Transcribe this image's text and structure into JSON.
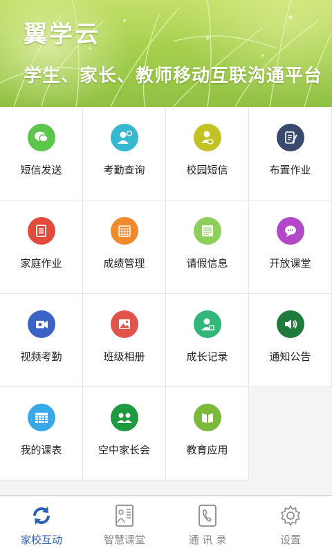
{
  "header": {
    "title": "翼学云",
    "subtitle": "学生、家长、教师移动互联沟通平台"
  },
  "grid": {
    "items": [
      {
        "label": "短信发送",
        "icon": "chat-bubble-icon",
        "color": "#5cc54b"
      },
      {
        "label": "考勤查询",
        "icon": "person-check-icon",
        "color": "#36b8cf"
      },
      {
        "label": "校园短信",
        "icon": "person-message-icon",
        "color": "#c2c224"
      },
      {
        "label": "布置作业",
        "icon": "edit-document-icon",
        "color": "#3a4a6e"
      },
      {
        "label": "家庭作业",
        "icon": "list-document-icon",
        "color": "#e24b3b"
      },
      {
        "label": "成绩管理",
        "icon": "calendar-grid-icon",
        "color": "#f08a2c"
      },
      {
        "label": "请假信息",
        "icon": "leave-form-icon",
        "color": "#8ccf5a"
      },
      {
        "label": "开放课堂",
        "icon": "speech-bubble-icon",
        "color": "#b447c8"
      },
      {
        "label": "视频考勤",
        "icon": "video-camera-icon",
        "color": "#3b63c6"
      },
      {
        "label": "班级相册",
        "icon": "photo-album-icon",
        "color": "#e0544b"
      },
      {
        "label": "成长记录",
        "icon": "person-badge-icon",
        "color": "#2fb87a"
      },
      {
        "label": "通知公告",
        "icon": "speaker-icon",
        "color": "#1f7a3c"
      },
      {
        "label": "我的课表",
        "icon": "timetable-icon",
        "color": "#39a8e8"
      },
      {
        "label": "空中家长会",
        "icon": "group-people-icon",
        "color": "#1f9a3e"
      },
      {
        "label": "教育应用",
        "icon": "book-app-icon",
        "color": "#7ab93a"
      }
    ]
  },
  "tabbar": {
    "tabs": [
      {
        "label": "家校互动",
        "icon": "refresh-arrows-icon",
        "active": true
      },
      {
        "label": "智慧课堂",
        "icon": "classroom-board-icon",
        "active": false
      },
      {
        "label": "通 讯 录",
        "icon": "phone-book-icon",
        "active": false
      },
      {
        "label": "设置",
        "icon": "gear-icon",
        "active": false
      }
    ],
    "active_color": "#2c5fb8",
    "inactive_color": "#8a8a8a"
  }
}
